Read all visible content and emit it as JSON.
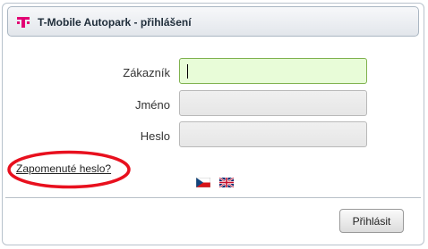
{
  "dialog": {
    "title": "T-Mobile Autopark - přihlášení",
    "logo_icon": "t-mobile-logo-icon",
    "brand_color": "#e20074"
  },
  "form": {
    "fields": [
      {
        "label": "Zákazník",
        "value": "",
        "active": true,
        "active_color": "#e8fcd8"
      },
      {
        "label": "Jméno",
        "value": ""
      },
      {
        "label": "Heslo",
        "value": ""
      }
    ],
    "forgot_password_link": "Zapomenuté heslo?",
    "language_flags": [
      "flag-cz-icon",
      "flag-uk-icon"
    ],
    "annotation_color": "#e8101e"
  },
  "footer": {
    "login_button": "Přihlásit"
  }
}
